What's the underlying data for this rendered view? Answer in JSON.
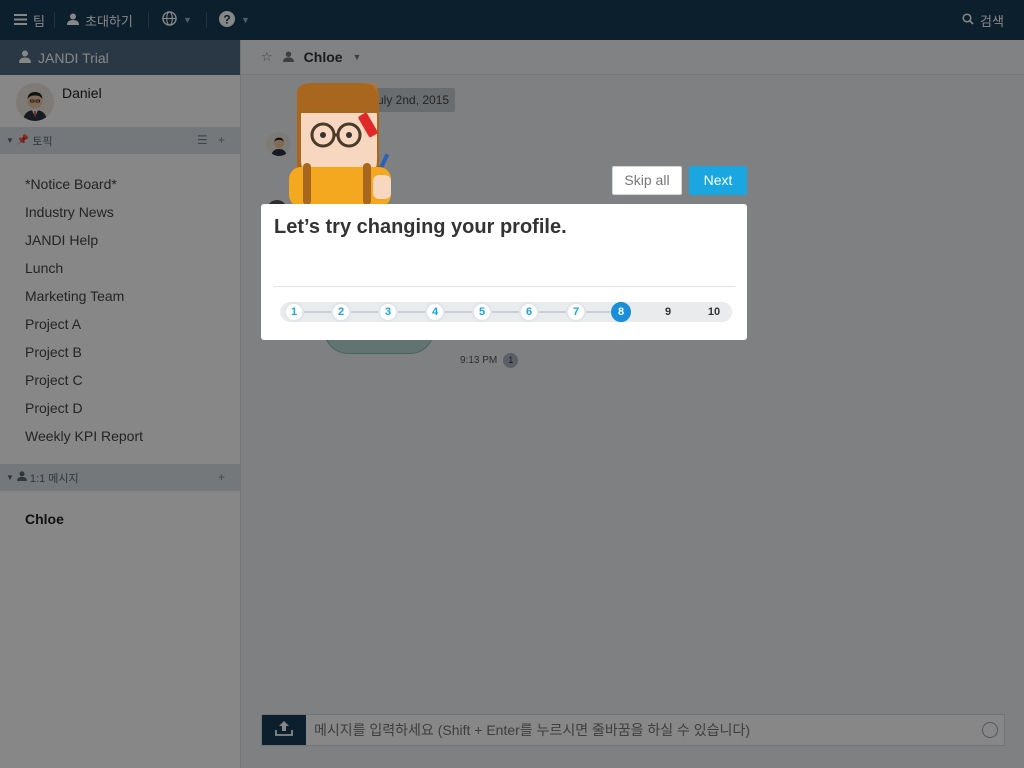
{
  "topbar": {
    "team_label": "팀",
    "invite_label": "초대하기",
    "search_label": "검색"
  },
  "sidebar": {
    "team_name": "JANDI Trial",
    "user_name": "Daniel",
    "topics_header": "토픽",
    "topics": [
      "*Notice Board*",
      "Industry News",
      "JANDI Help",
      "Lunch",
      "Marketing Team",
      "Project A",
      "Project B",
      "Project C",
      "Project D",
      "Weekly KPI Report"
    ],
    "dm_header": "1:1 메시지",
    "dms": [
      "Chloe"
    ]
  },
  "main": {
    "channel_name": "Chloe",
    "date_label": "July 2nd, 2015",
    "message_time": "9:13 PM",
    "unread_count": "1",
    "composer_placeholder": "메시지를 입력하세요 (Shift + Enter를 누르시면 줄바꿈을 하실 수 있습니다)"
  },
  "tour": {
    "skip_label": "Skip all",
    "next_label": "Next",
    "title": "Let’s try changing your profile.",
    "steps": [
      "1",
      "2",
      "3",
      "4",
      "5",
      "6",
      "7",
      "8",
      "9",
      "10"
    ],
    "current_step": 8
  },
  "colors": {
    "topbar": "#173b55",
    "accent": "#1aa7e1",
    "team_bar": "#4e6b80"
  }
}
